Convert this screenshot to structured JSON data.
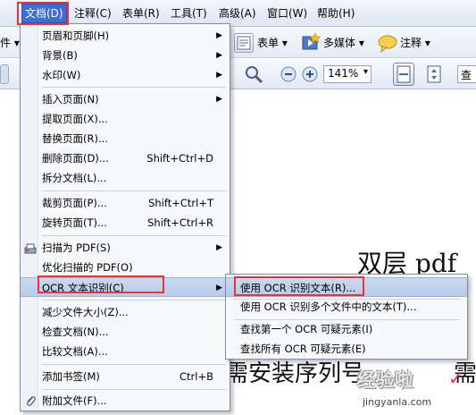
{
  "menubar": {
    "stub_left": "",
    "items": [
      {
        "label": "文档(D)",
        "active": true
      },
      {
        "label": "注释(C)"
      },
      {
        "label": "表单(R)"
      },
      {
        "label": "工具(T)"
      },
      {
        "label": "高级(A)"
      },
      {
        "label": "窗口(W)"
      },
      {
        "label": "帮助(H)"
      }
    ]
  },
  "toolbar": {
    "left_stub": "件 ▾",
    "form_button": "表单 ▾",
    "multimedia_button": "多媒体 ▾",
    "comment_button": "注释 ▾",
    "zoom_value": "141%",
    "zoom_dropdown": "▾",
    "search_stub": "查"
  },
  "document": {
    "heading_fragment": "双层 pdf",
    "body_fragment": "需安装序列号",
    "body_tail": "需"
  },
  "menu": {
    "items": [
      {
        "label": "页眉和页脚(H)",
        "submenu": true
      },
      {
        "label": "背景(B)",
        "submenu": true
      },
      {
        "label": "水印(W)",
        "submenu": true
      },
      {
        "label": "插入页面(N)",
        "submenu": true
      },
      {
        "label": "提取页面(X)..."
      },
      {
        "label": "替换页面(R)..."
      },
      {
        "label": "删除页面(D)...",
        "shortcut": "Shift+Ctrl+D"
      },
      {
        "label": "拆分文档(L)..."
      },
      {
        "label": "裁剪页面(P)...",
        "shortcut": "Shift+Ctrl+T"
      },
      {
        "label": "旋转页面(T)...",
        "shortcut": "Shift+Ctrl+R"
      },
      {
        "label": "扫描为 PDF(S)",
        "submenu": true,
        "icon": "scanner-icon"
      },
      {
        "label": "优化扫描的 PDF(O)"
      },
      {
        "label": "OCR 文本识别(C)",
        "submenu": true,
        "highlighted": true
      },
      {
        "label": "减少文件大小(Z)..."
      },
      {
        "label": "检查文档(N)..."
      },
      {
        "label": "比较文档(A)..."
      },
      {
        "label": "添加书签(M)",
        "shortcut": "Ctrl+B"
      },
      {
        "label": "附加文件(F)...",
        "icon": "paperclip-icon"
      }
    ]
  },
  "submenu": {
    "items": [
      {
        "label": "使用 OCR 识别文本(R)...",
        "highlighted": true
      },
      {
        "label": "使用 OCR 识别多个文件中的文本(T)..."
      },
      {
        "label": "查找第一个 OCR 可疑元素(I)"
      },
      {
        "label": "查找所有 OCR 可疑元素(E)"
      }
    ]
  },
  "watermark": {
    "main": "经验啦",
    "check": "✓",
    "sub": "jingyanla.com"
  },
  "colors": {
    "highlight_red": "#e8333a",
    "menu_active": "#3b6fd6",
    "menu_hover": "#c9d9ef"
  }
}
